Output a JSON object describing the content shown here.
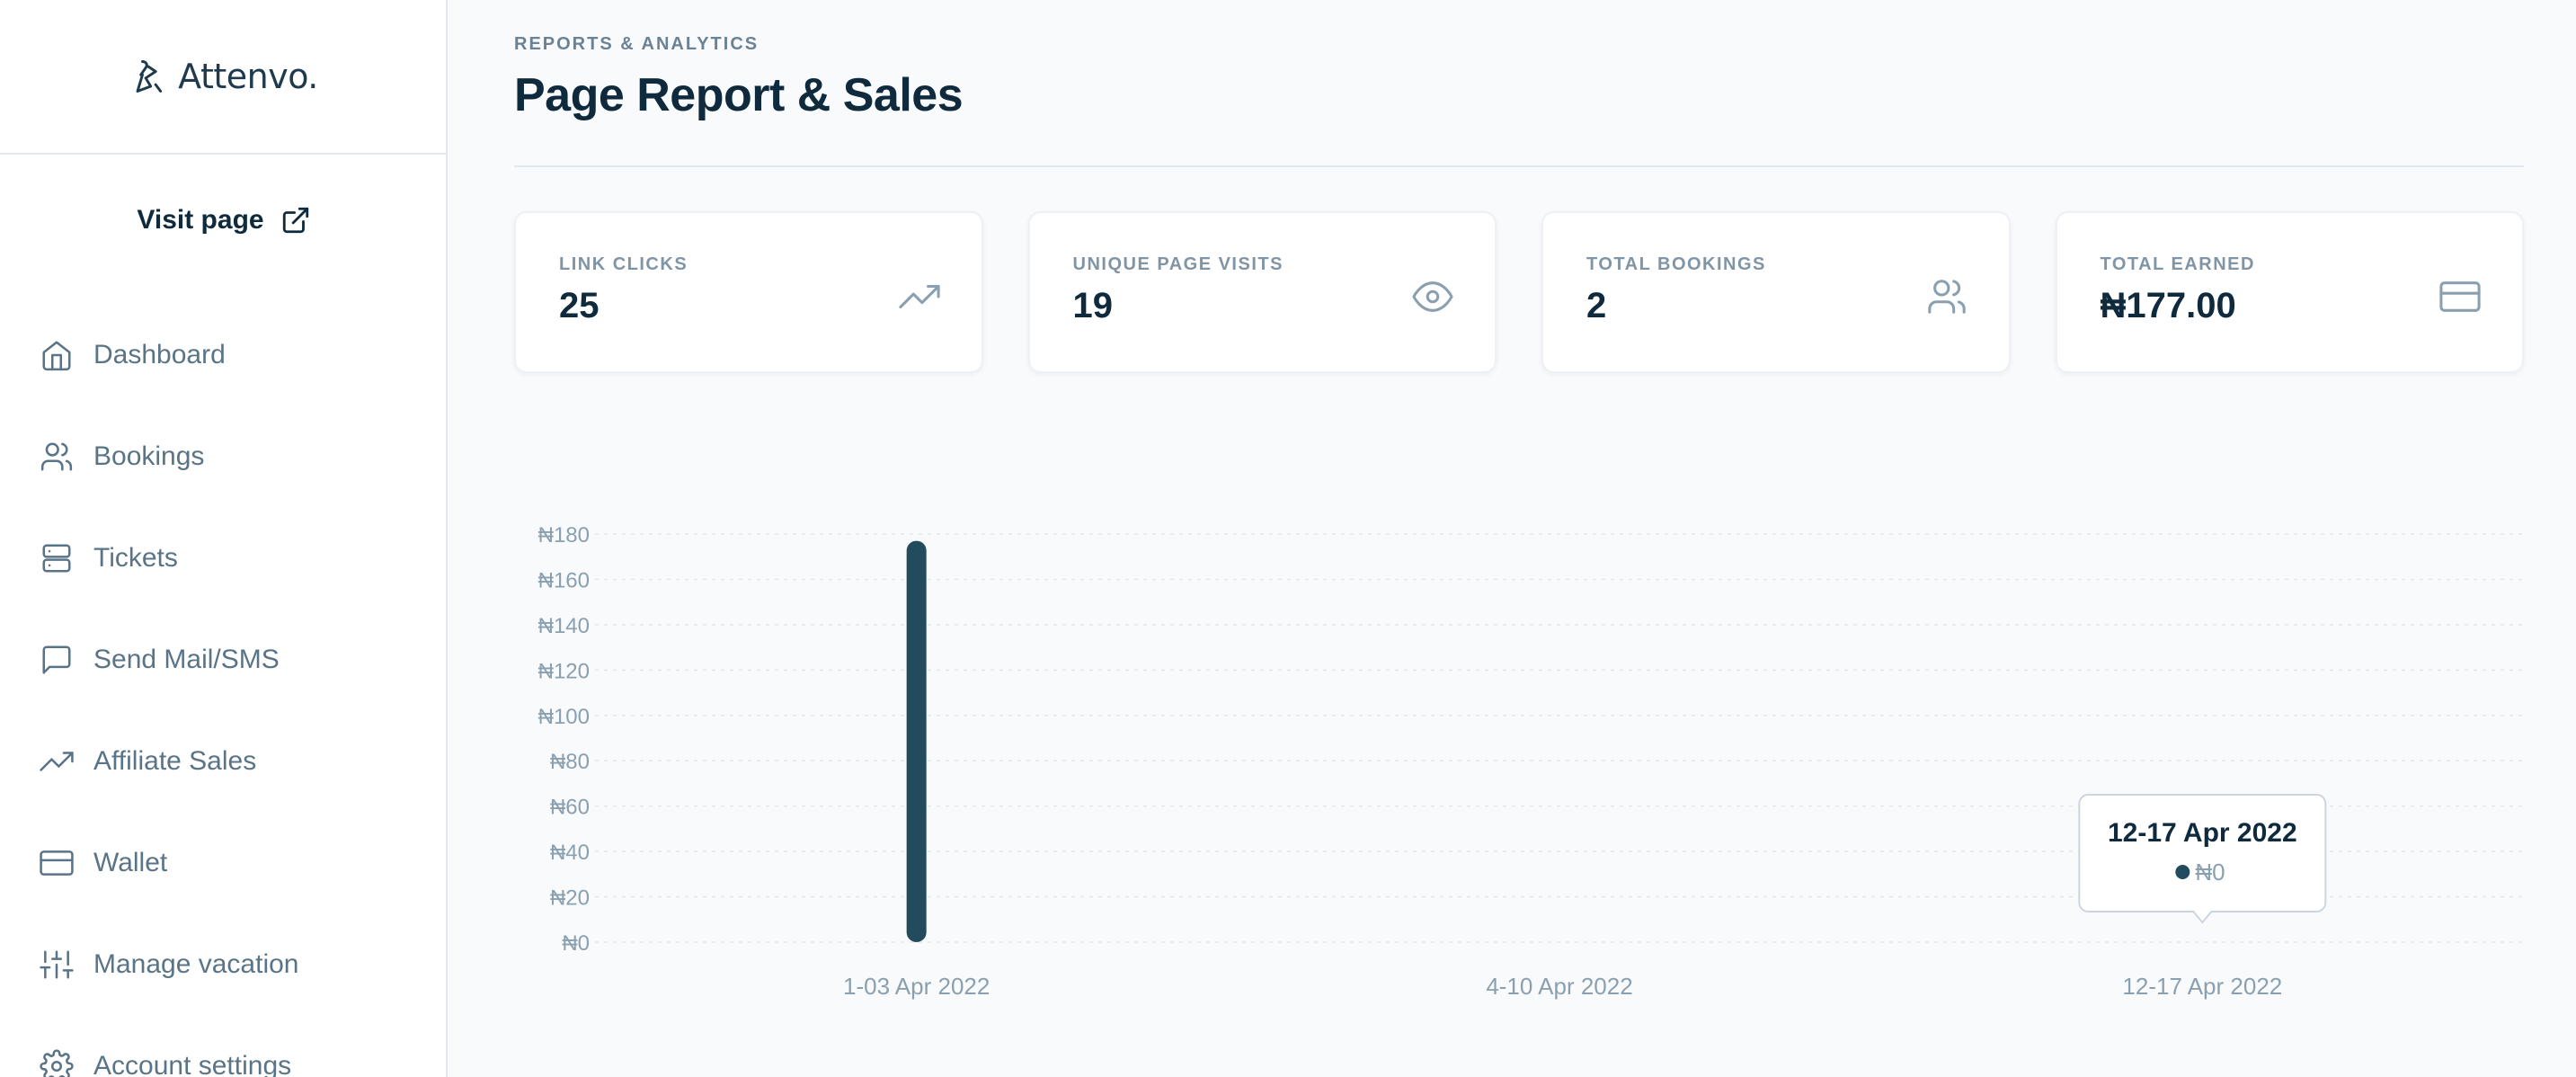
{
  "brand": {
    "name": "Attenvo."
  },
  "sidebar": {
    "visit_label": "Visit page",
    "items": [
      {
        "label": "Dashboard",
        "icon": "home-icon"
      },
      {
        "label": "Bookings",
        "icon": "users-icon"
      },
      {
        "label": "Tickets",
        "icon": "server-icon"
      },
      {
        "label": "Send Mail/SMS",
        "icon": "message-icon"
      },
      {
        "label": "Affiliate Sales",
        "icon": "trending-up-icon"
      },
      {
        "label": "Wallet",
        "icon": "credit-card-icon"
      },
      {
        "label": "Manage vacation",
        "icon": "sliders-icon"
      },
      {
        "label": "Account settings",
        "icon": "gear-icon"
      }
    ]
  },
  "header": {
    "eyebrow": "REPORTS & ANALYTICS",
    "title": "Page Report & Sales"
  },
  "stats": [
    {
      "label": "LINK CLICKS",
      "value": "25",
      "icon": "trending-up-icon"
    },
    {
      "label": "UNIQUE PAGE VISITS",
      "value": "19",
      "icon": "eye-icon"
    },
    {
      "label": "TOTAL BOOKINGS",
      "value": "2",
      "icon": "users-icon"
    },
    {
      "label": "TOTAL EARNED",
      "value": "₦177.00",
      "icon": "credit-card-icon"
    }
  ],
  "colors": {
    "bar": "#234b5e",
    "text": "#0f2a3d",
    "muted": "#8aa0b0",
    "grid": "#e2e8f0"
  },
  "chart_data": {
    "type": "bar",
    "categories": [
      "1-03 Apr 2022",
      "4-10 Apr 2022",
      "12-17 Apr 2022"
    ],
    "values": [
      177,
      0,
      0
    ],
    "ylim": [
      0,
      180
    ],
    "yticks": [
      {
        "value": 0,
        "label": "₦0"
      },
      {
        "value": 20,
        "label": "₦20"
      },
      {
        "value": 40,
        "label": "₦40"
      },
      {
        "value": 60,
        "label": "₦60"
      },
      {
        "value": 80,
        "label": "₦80"
      },
      {
        "value": 100,
        "label": "₦100"
      },
      {
        "value": 120,
        "label": "₦120"
      },
      {
        "value": 140,
        "label": "₦140"
      },
      {
        "value": 160,
        "label": "₦160"
      },
      {
        "value": 180,
        "label": "₦180"
      }
    ],
    "grid": true,
    "tooltip": {
      "category": "12-17 Apr 2022",
      "value_label": "₦0"
    }
  }
}
